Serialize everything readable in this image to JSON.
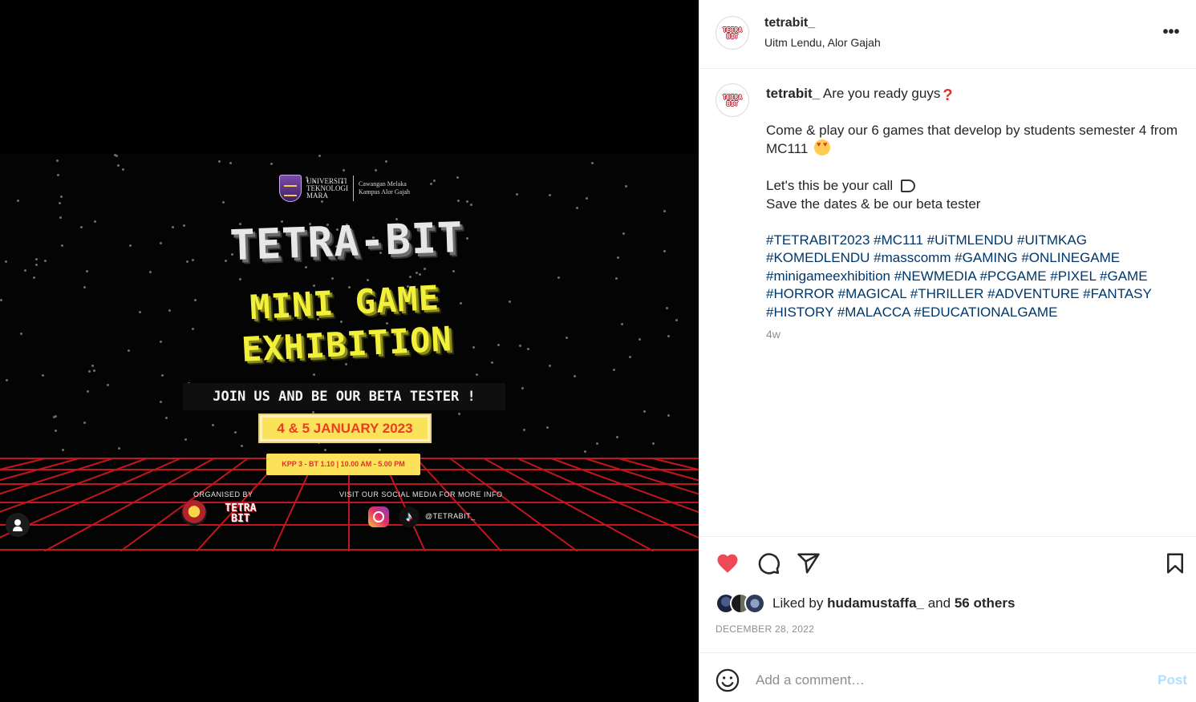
{
  "poster": {
    "uni_name": "UNIVERSITI TEKNOLOGI MARA",
    "campus": "Cawangan Melaka Kampus Alor Gajah",
    "title": "TETRA-BIT",
    "subtitle_line1": "MINI GAME",
    "subtitle_line2": "EXHIBITION",
    "tagline": "JOIN US AND BE OUR BETA TESTER !",
    "date": "4 & 5 JANUARY 2023",
    "venue": "KPP 3 - BT 1.10 | 10.00 AM - 5.00 PM",
    "organised_by": "ORGANISED BY",
    "org_logo_text": "TETRA BIT",
    "visit_text": "VISIT OUR SOCIAL MEDIA FOR MORE INFO",
    "social_handle": "@TETRABIT_"
  },
  "header": {
    "avatar_text": "TETRA BIT",
    "username": "tetrabit_",
    "location": "Uitm Lendu, Alor Gajah",
    "more_label": "•••"
  },
  "caption": {
    "username": "tetrabit_",
    "line1": "Are you ready guys",
    "line2": "Come & play our 6 games that develop by students semester 4 from MC111",
    "line3": "Let's this be your call",
    "line4": "Save the dates & be our beta tester",
    "hashtags": "#TETRABIT2023 #MC111 #UiTMLENDU #UITMKAG #KOMEDLENDU #masscomm #GAMING #ONLINEGAME #minigameexhibition #NEWMEDIA #PCGAME #PIXEL #GAME #HORROR #MAGICAL #THRILLER #ADVENTURE #FANTASY #HISTORY #MALACCA #EDUCATIONALGAME",
    "time": "4w"
  },
  "likes": {
    "prefix": "Liked by",
    "user": "hudamustaffa_",
    "joiner": "and",
    "others": "56 others"
  },
  "post_date": "DECEMBER 28, 2022",
  "comment": {
    "placeholder": "Add a comment…",
    "post_label": "Post"
  },
  "colors": {
    "like_red": "#ed4956",
    "hashtag_blue": "#00376b",
    "post_button_disabled": "#b2dffc",
    "poster_yellow": "#fce25a",
    "grid_red": "#c2161e"
  },
  "icons": [
    "user-tag-icon",
    "more-icon",
    "heart-icon",
    "comment-icon",
    "share-icon",
    "save-icon",
    "emoji-icon"
  ]
}
